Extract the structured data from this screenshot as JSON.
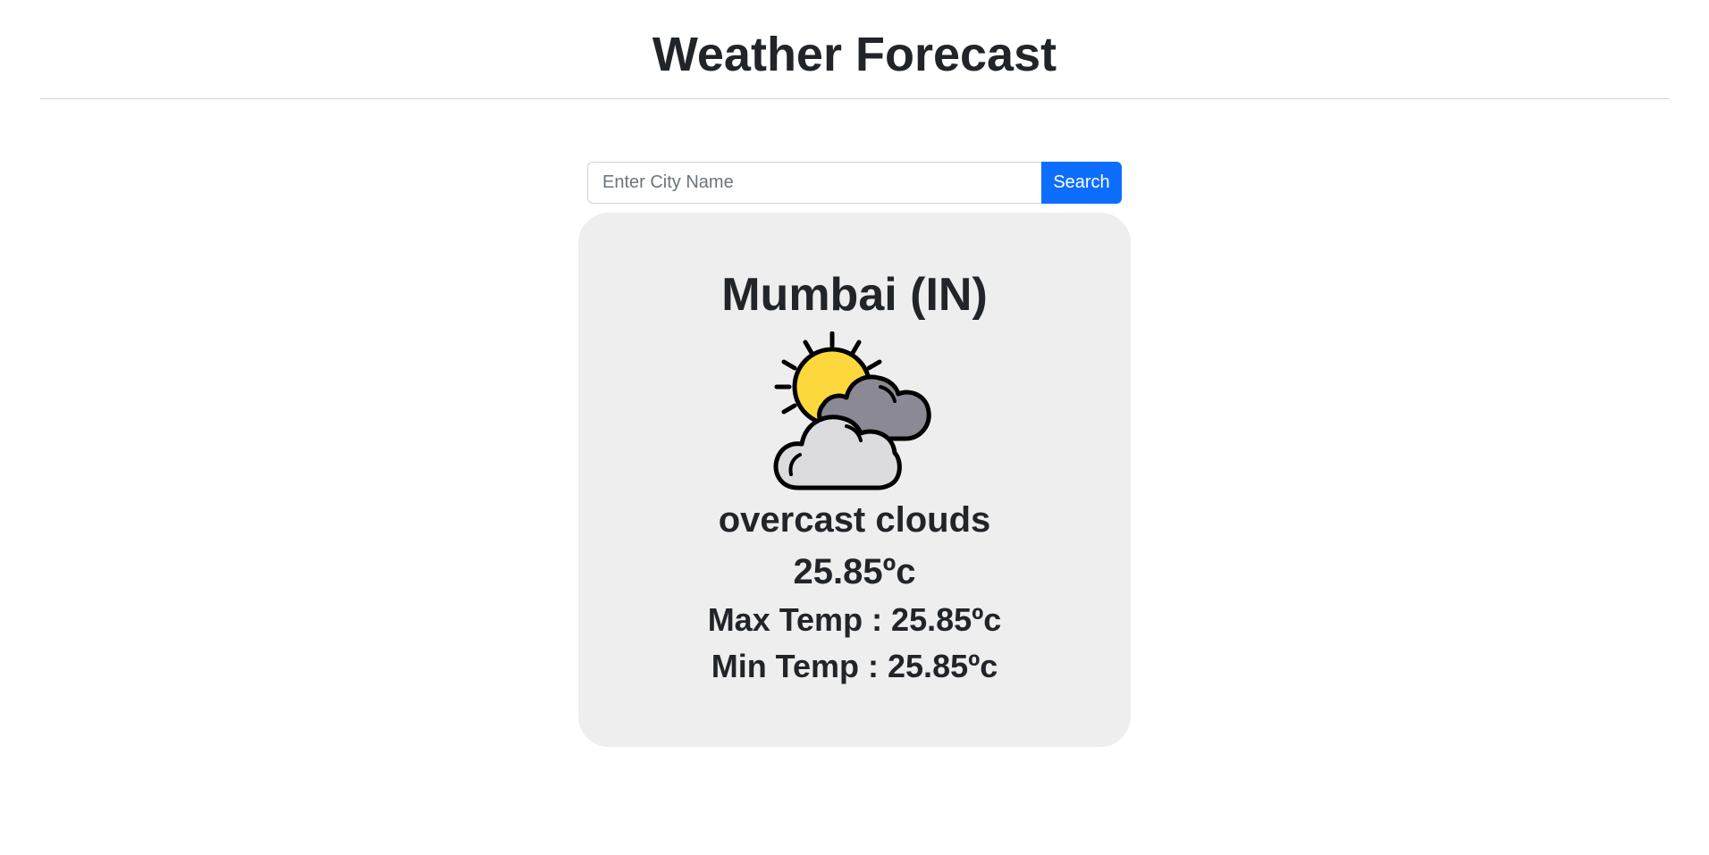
{
  "header": {
    "title": "Weather Forecast"
  },
  "search": {
    "placeholder": "Enter City Name",
    "value": "",
    "button_label": "Search"
  },
  "weather": {
    "city": "Mumbai (IN)",
    "icon": "sun-behind-clouds-icon",
    "description": "overcast clouds",
    "temperature": "25.85ºc",
    "max_temp": "Max Temp : 25.85ºc",
    "min_temp": "Min Temp : 25.85ºc"
  },
  "colors": {
    "accent": "#0d6efd",
    "card_background": "#eeeeee",
    "text": "#212529",
    "sun": "#fdd83d",
    "cloud_dark": "#8b8a94",
    "cloud_light": "#dcdcde"
  }
}
